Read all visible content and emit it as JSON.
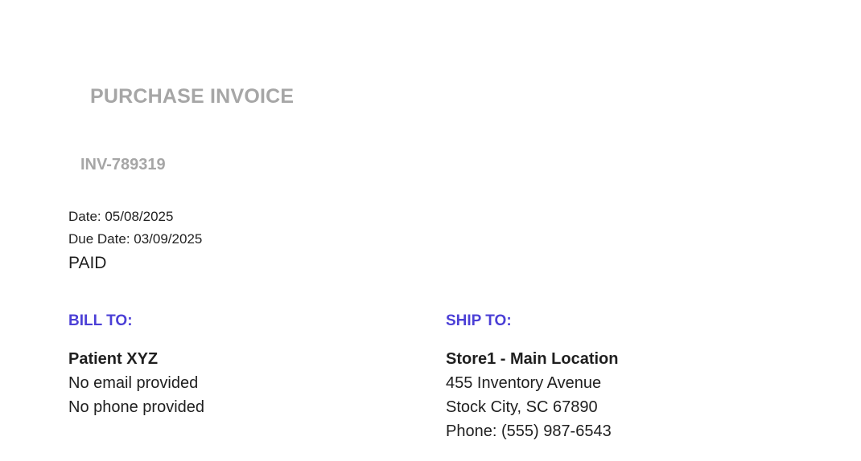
{
  "invoice": {
    "title": "PURCHASE INVOICE",
    "number": "INV-789319",
    "date_line": "Date: 05/08/2025",
    "due_date_line": "Due Date: 03/09/2025",
    "status": "PAID"
  },
  "bill_to": {
    "heading": "BILL TO:",
    "name": "Patient XYZ",
    "lines": [
      "No email provided",
      "No phone provided"
    ]
  },
  "ship_to": {
    "heading": "SHIP TO:",
    "name": "Store1 - Main Location",
    "lines": [
      "455 Inventory Avenue",
      "Stock City, SC 67890",
      "Phone: (555) 987-6543"
    ]
  },
  "colors": {
    "accent": "#4b3fd6",
    "muted_title": "#a6a6a6",
    "text": "#1f1f1f"
  }
}
